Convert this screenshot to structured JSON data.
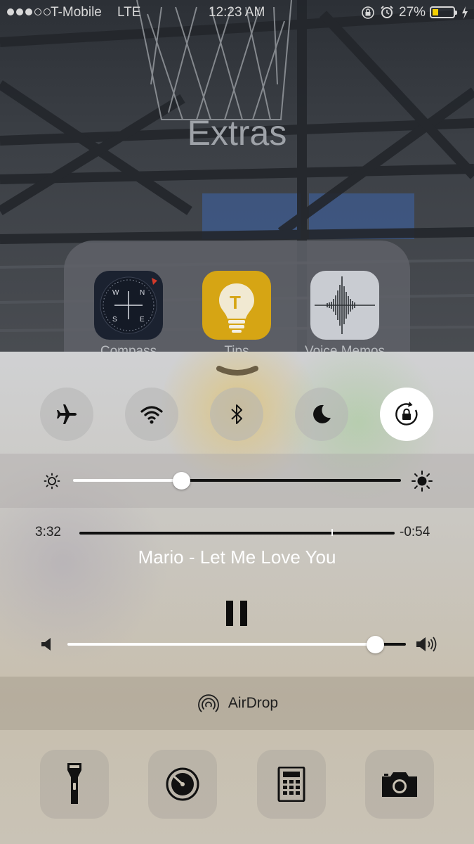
{
  "status_bar": {
    "carrier": "T-Mobile",
    "network": "LTE",
    "time": "12:23 AM",
    "battery": "27%",
    "signal_bars_full": 3,
    "signal_bars_total": 5,
    "battery_level": 0.27,
    "battery_color": "#f5d000"
  },
  "folder": {
    "title": "Extras",
    "apps": [
      {
        "label": "Compass",
        "icon": "compass-icon"
      },
      {
        "label": "Tips",
        "icon": "tips-lightbulb-icon"
      },
      {
        "label": "Voice Memos",
        "icon": "voice-memos-waveform-icon"
      }
    ]
  },
  "control_center": {
    "toggles": [
      {
        "name": "airplane-mode",
        "icon": "airplane-icon",
        "active": false
      },
      {
        "name": "wifi",
        "icon": "wifi-icon",
        "active": false
      },
      {
        "name": "bluetooth",
        "icon": "bluetooth-icon",
        "active": false
      },
      {
        "name": "do-not-disturb",
        "icon": "moon-icon",
        "active": false
      },
      {
        "name": "rotation-lock",
        "icon": "rotation-lock-icon",
        "active": true
      }
    ],
    "brightness_level": 0.33,
    "music": {
      "elapsed": "3:32",
      "remaining": "-0:54",
      "progress": 0.8,
      "song_title": "Mario - Let Me Love You",
      "play_state": "playing",
      "volume_level": 0.91
    },
    "airdrop_label": "AirDrop",
    "quick_launch": [
      {
        "name": "flashlight",
        "icon": "flashlight-icon"
      },
      {
        "name": "timer",
        "icon": "timer-icon"
      },
      {
        "name": "calculator",
        "icon": "calculator-icon"
      },
      {
        "name": "camera",
        "icon": "camera-icon"
      }
    ]
  }
}
